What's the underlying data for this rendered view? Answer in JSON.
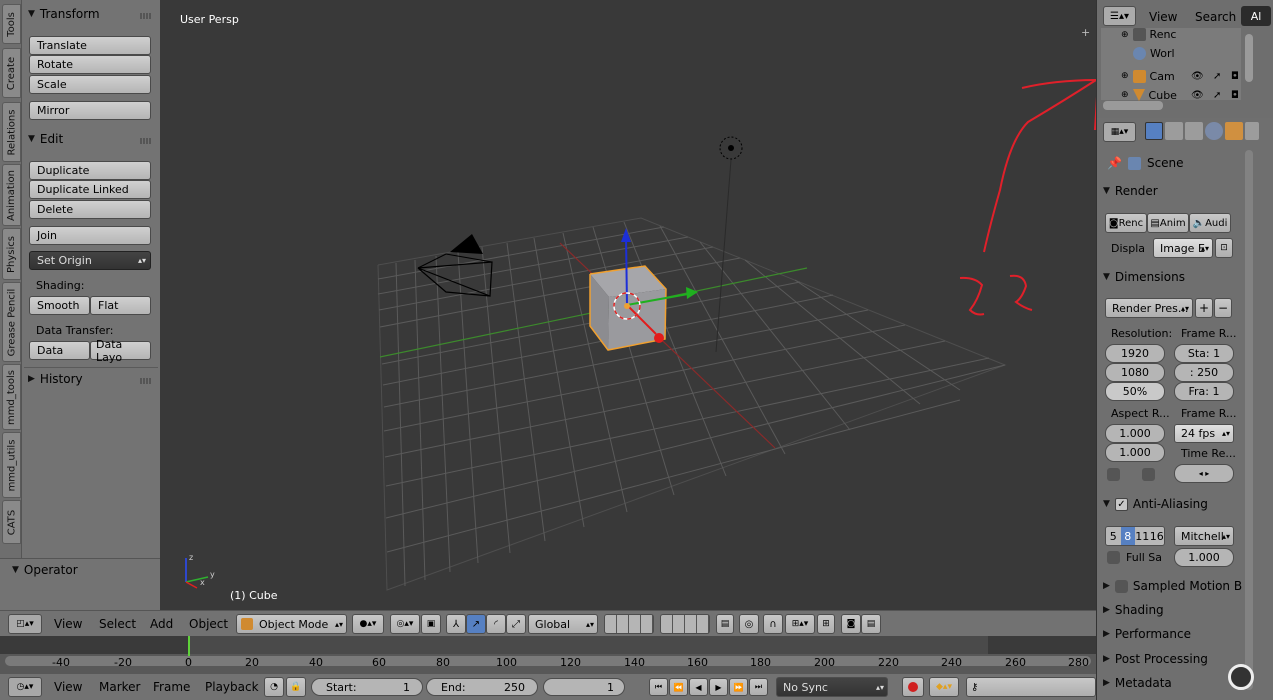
{
  "toolshelf": {
    "tabs": [
      "Tools",
      "Create",
      "Relations",
      "Animation",
      "Physics",
      "Grease Pencil",
      "mmd_tools",
      "mmd_utils",
      "CATS"
    ],
    "transform": {
      "title": "Transform",
      "translate": "Translate",
      "rotate": "Rotate",
      "scale": "Scale",
      "mirror": "Mirror"
    },
    "edit": {
      "title": "Edit",
      "duplicate": "Duplicate",
      "duplicate_linked": "Duplicate Linked",
      "delete": "Delete",
      "join": "Join",
      "set_origin": "Set Origin",
      "shading_label": "Shading:",
      "smooth": "Smooth",
      "flat": "Flat",
      "transfer_label": "Data Transfer:",
      "data": "Data",
      "data_layo": "Data Layo"
    },
    "history": "History",
    "operator": "Operator"
  },
  "viewport": {
    "persp_label": "User Persp",
    "object_label": "(1) Cube"
  },
  "outliner": {
    "view": "View",
    "search": "Search",
    "all": "Al",
    "items": [
      "Renc",
      "Worl",
      "Cam",
      "Cube"
    ]
  },
  "properties": {
    "scene": "Scene",
    "render": {
      "title": "Render",
      "render_btn": "Renc",
      "anim_btn": "Anim",
      "audio_btn": "Audi",
      "display_label": "Displa",
      "display_value": "Image E"
    },
    "dimensions": {
      "title": "Dimensions",
      "presets": "Render Pres...",
      "resolution_label": "Resolution:",
      "frame_range_label": "Frame R...",
      "res_x": "1920",
      "res_y": "1080",
      "res_pct": "50%",
      "start": "Sta: 1",
      "end": ": 250",
      "step": "Fra: 1",
      "aspect_label": "Aspect R...",
      "frame_rate_label": "Frame R...",
      "aspect_x": "1.000",
      "aspect_y": "1.000",
      "fps": "24 fps",
      "time_remap_label": "Time Re..."
    },
    "antialiasing": {
      "title": "Anti-Aliasing",
      "samples": [
        "5",
        "8",
        "11",
        "16"
      ],
      "filter": "Mitchell",
      "full_sample": "Full Sa",
      "filter_size": "1.000"
    },
    "collapsed": [
      "Sampled Motion B",
      "Shading",
      "Performance",
      "Post Processing",
      "Metadata"
    ]
  },
  "header": {
    "view": "View",
    "select": "Select",
    "add": "Add",
    "object": "Object",
    "mode": "Object Mode",
    "orientation": "Global"
  },
  "timeline": {
    "ticks": [
      "-40",
      "-20",
      "0",
      "20",
      "40",
      "60",
      "80",
      "100",
      "120",
      "140",
      "160",
      "180",
      "200",
      "220",
      "240",
      "260",
      "280"
    ]
  },
  "playback_bar": {
    "view": "View",
    "marker": "Marker",
    "frame": "Frame",
    "playback": "Playback",
    "start_label": "Start:",
    "start_value": "1",
    "end_label": "End:",
    "end_value": "250",
    "current": "1",
    "sync": "No Sync"
  },
  "colors": {
    "selection_orange": "#f0a030",
    "annotation_red": "#e0202a",
    "accent_blue": "#5680c2"
  }
}
